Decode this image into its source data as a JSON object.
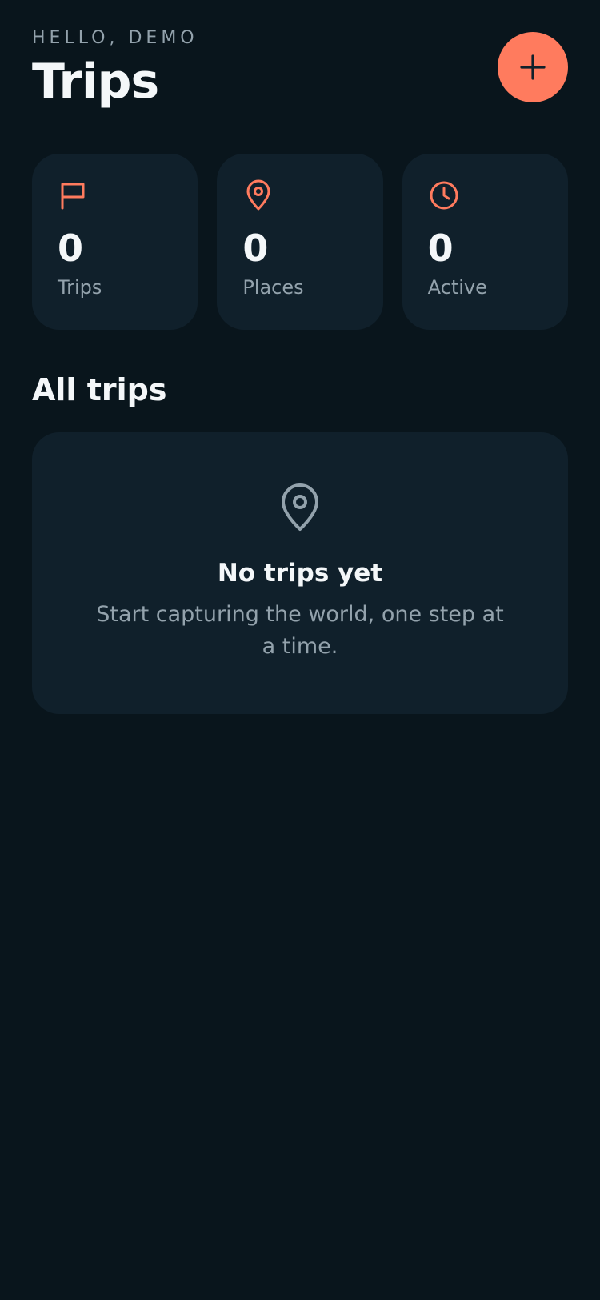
{
  "header": {
    "greeting": "HELLO, DEMO",
    "title": "Trips",
    "add_button_icon": "plus-icon"
  },
  "stats": [
    {
      "icon": "flag-icon",
      "value": "0",
      "label": "Trips"
    },
    {
      "icon": "map-pin-icon",
      "value": "0",
      "label": "Places"
    },
    {
      "icon": "clock-icon",
      "value": "0",
      "label": "Active"
    }
  ],
  "section": {
    "title": "All trips"
  },
  "empty_state": {
    "icon": "map-pin-icon",
    "title": "No trips yet",
    "text": "Start capturing the world, one step at a time."
  },
  "colors": {
    "background": "#09151c",
    "card": "#10202b",
    "accent": "#ff7b5e",
    "text_primary": "#f4f7f9",
    "text_secondary": "#93a2ac"
  }
}
